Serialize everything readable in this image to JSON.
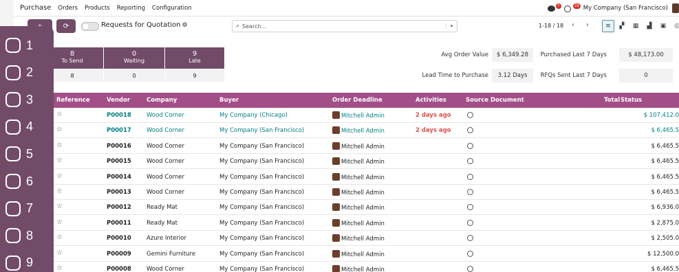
{
  "nav": {
    "app_name": "Purchase",
    "menus": [
      "Orders",
      "Products",
      "Reporting",
      "Configuration"
    ],
    "chat_badge": "7",
    "activity_badge": "29",
    "company": "My Company (San Francisco)"
  },
  "control": {
    "page_title": "Requests for Quotation",
    "search_placeholder": "Search...",
    "pager": "1-18 / 18"
  },
  "dashboard": {
    "tiles": [
      {
        "count": "8",
        "label": "To Send",
        "sub": "8"
      },
      {
        "count": "0",
        "label": "Waiting",
        "sub": "0"
      },
      {
        "count": "9",
        "label": "Late",
        "sub": "9"
      }
    ],
    "stats": [
      {
        "label": "Avg Order Value",
        "value": "$ 6,349.28"
      },
      {
        "label": "Purchased Last 7 Days",
        "value": "$ 48,173.00"
      },
      {
        "label": "Lead Time to Purchase",
        "value": "3.12 Days"
      },
      {
        "label": "RFQs Sent Last 7 Days",
        "value": "0"
      }
    ]
  },
  "table": {
    "headers": [
      "Reference",
      "Vendor",
      "Company",
      "Buyer",
      "Order Deadline",
      "Activities",
      "Source Document",
      "Total",
      "Status"
    ],
    "rows": [
      {
        "ref": "P00018",
        "vendor": "Wood Corner",
        "buyer": "My Company (Chicago)",
        "deadline": "Mitchell Admin",
        "activity": "2 days ago",
        "total": "$ 107,412.0",
        "highlight": true
      },
      {
        "ref": "P00017",
        "vendor": "Wood Corner",
        "buyer": "My Company (San Francisco)",
        "deadline": "Mitchell Admin",
        "activity": "2 days ago",
        "total": "$ 6,465.5",
        "highlight": true
      },
      {
        "ref": "P00016",
        "vendor": "Wood Corner",
        "buyer": "My Company (San Francisco)",
        "deadline": "Mitchell Admin",
        "activity": "",
        "total": "$ 6,465.5",
        "highlight": false
      },
      {
        "ref": "P00015",
        "vendor": "Wood Corner",
        "buyer": "My Company (San Francisco)",
        "deadline": "Mitchell Admin",
        "activity": "",
        "total": "$ 6,465.5",
        "highlight": false
      },
      {
        "ref": "P00014",
        "vendor": "Wood Corner",
        "buyer": "My Company (San Francisco)",
        "deadline": "Mitchell Admin",
        "activity": "",
        "total": "$ 6,465.5",
        "highlight": false
      },
      {
        "ref": "P00013",
        "vendor": "Wood Corner",
        "buyer": "My Company (San Francisco)",
        "deadline": "Mitchell Admin",
        "activity": "",
        "total": "$ 6,465.5",
        "highlight": false
      },
      {
        "ref": "P00012",
        "vendor": "Ready Mat",
        "buyer": "My Company (San Francisco)",
        "deadline": "Mitchell Admin",
        "activity": "",
        "total": "$ 6,936.0",
        "highlight": false
      },
      {
        "ref": "P00011",
        "vendor": "Ready Mat",
        "buyer": "My Company (San Francisco)",
        "deadline": "Mitchell Admin",
        "activity": "",
        "total": "$ 2,875.0",
        "highlight": false
      },
      {
        "ref": "P00010",
        "vendor": "Azure Interior",
        "buyer": "My Company (San Francisco)",
        "deadline": "Mitchell Admin",
        "activity": "",
        "total": "$ 2,505.0",
        "highlight": false
      },
      {
        "ref": "P00009",
        "vendor": "Gemini Furniture",
        "buyer": "My Company (San Francisco)",
        "deadline": "Mitchell Admin",
        "activity": "",
        "total": "$ 12,500.0",
        "highlight": false
      },
      {
        "ref": "P00008",
        "vendor": "Wood Corner",
        "buyer": "My Company (San Francisco)",
        "deadline": "Mitchell Admin",
        "activity": "",
        "total": "$ 6,465.5",
        "highlight": false
      }
    ]
  },
  "overlay": {
    "items": [
      "1",
      "2",
      "3",
      "4",
      "5",
      "6",
      "7",
      "8",
      "9"
    ]
  },
  "colors": {
    "brand": "#714b67",
    "header_row": "#a24f88",
    "link": "#017e84",
    "overdue": "#d9534f"
  }
}
